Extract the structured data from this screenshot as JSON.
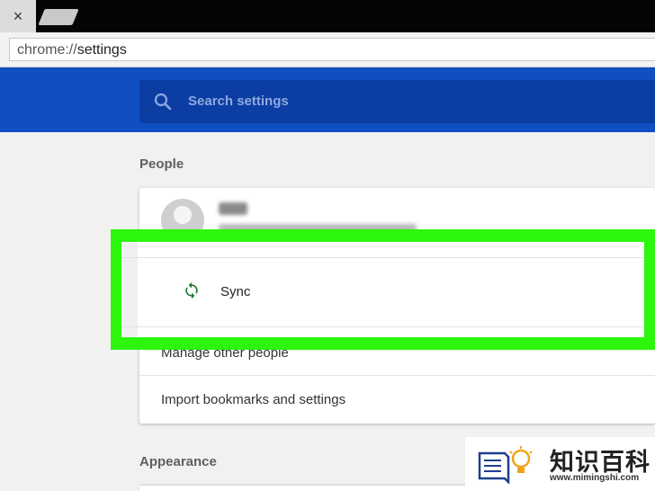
{
  "browser": {
    "tab_close_glyph": "×",
    "address_scheme": "chrome://",
    "address_host": "settings"
  },
  "search": {
    "placeholder": "Search settings"
  },
  "people": {
    "section_title": "People",
    "rows": {
      "sync": "Sync",
      "manage": "Manage other people",
      "import": "Import bookmarks and settings"
    }
  },
  "appearance": {
    "section_title": "Appearance"
  },
  "watermark": {
    "name": "知识百科",
    "url": "www.mimingshi.com"
  },
  "colors": {
    "header_blue": "#0f4fc2",
    "search_blue": "#0b3da3",
    "highlight_green": "#2cf60c",
    "sync_icon": "#1a7a2a"
  }
}
